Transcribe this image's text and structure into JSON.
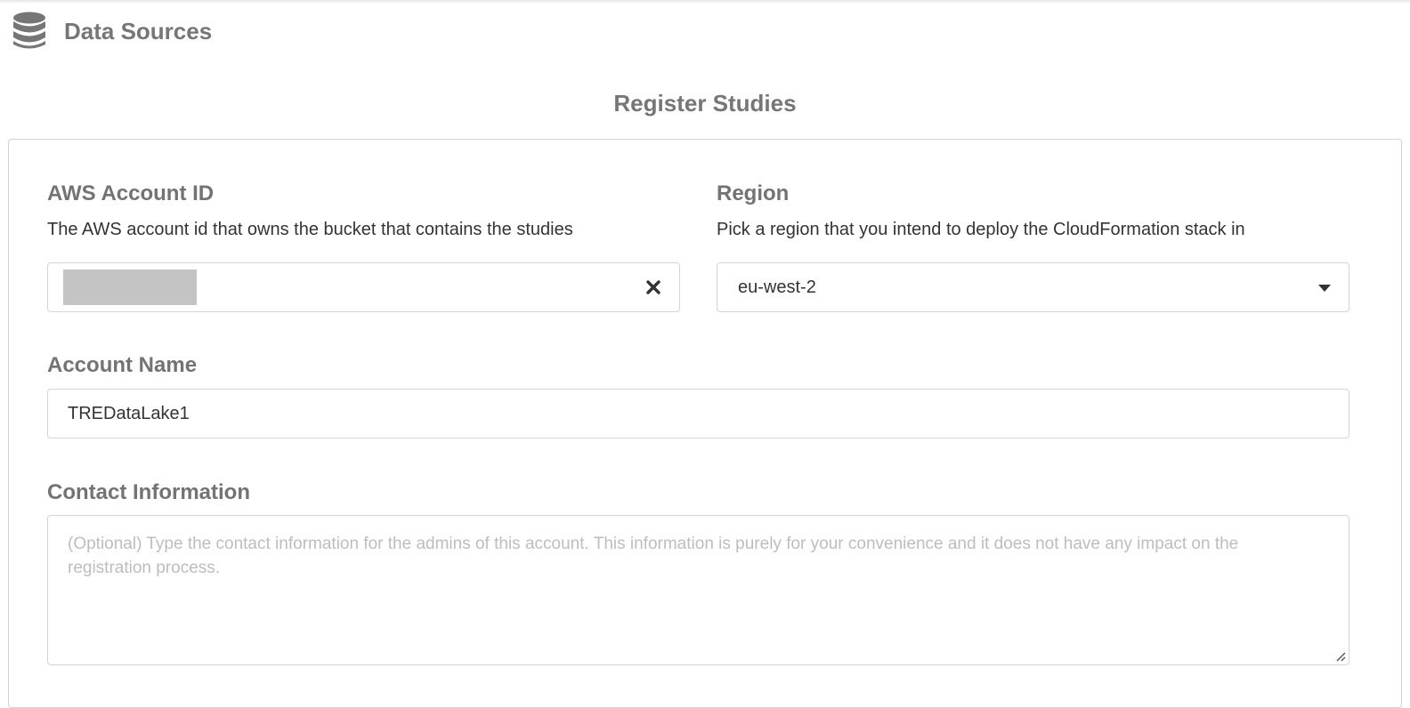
{
  "header": {
    "title": "Data Sources",
    "icon": "database-icon"
  },
  "page": {
    "title": "Register Studies"
  },
  "form": {
    "account_id": {
      "label": "AWS Account ID",
      "help": "The AWS account id that owns the bucket that contains the studies",
      "value_redacted": true,
      "clear_icon": "close-icon"
    },
    "region": {
      "label": "Region",
      "help": "Pick a region that you intend to deploy the CloudFormation stack in",
      "value": "eu-west-2",
      "dropdown_icon": "caret-down-icon"
    },
    "account_name": {
      "label": "Account Name",
      "value": "TREDataLake1"
    },
    "contact_info": {
      "label": "Contact Information",
      "value": "",
      "placeholder": "(Optional) Type the contact information for the admins of this account. This information is purely for your convenience and it does not have any impact on the registration process."
    }
  },
  "colors": {
    "label_gray": "#737373",
    "border": "#d4d4d5",
    "placeholder": "#bdbdbd",
    "redaction": "#c4c4c4"
  }
}
